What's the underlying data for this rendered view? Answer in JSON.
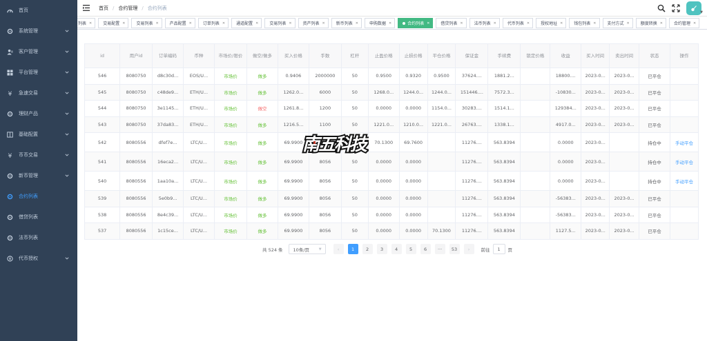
{
  "sidebar": {
    "items": [
      {
        "label": "首页",
        "icon": "dashboard-icon",
        "arrow": false
      },
      {
        "label": "系统管理",
        "icon": "gear-icon",
        "arrow": true
      },
      {
        "label": "客户管理",
        "icon": "user-icon",
        "arrow": true
      },
      {
        "label": "平台管理",
        "icon": "grid-icon",
        "arrow": true
      },
      {
        "label": "急速交易",
        "icon": "yen-icon",
        "arrow": true
      },
      {
        "label": "理财产品",
        "icon": "gear-icon",
        "arrow": true
      },
      {
        "label": "基础配置",
        "icon": "book-icon",
        "arrow": true
      },
      {
        "label": "币币交易",
        "icon": "yen-icon",
        "arrow": true
      },
      {
        "label": "新币管理",
        "icon": "gear-icon",
        "arrow": true
      },
      {
        "label": "合约列表",
        "icon": "gear-icon",
        "arrow": false,
        "active": true
      },
      {
        "label": "借贷列表",
        "icon": "gear-icon",
        "arrow": false
      },
      {
        "label": "法币列表",
        "icon": "gear-icon",
        "arrow": false
      },
      {
        "label": "代币授权",
        "icon": "compass-icon",
        "arrow": true
      }
    ]
  },
  "breadcrumb": {
    "home": "首页",
    "section": "合约管理",
    "current": "合约列表"
  },
  "tags": [
    {
      "label": "列表",
      "active": false
    },
    {
      "label": "交易配置",
      "active": false
    },
    {
      "label": "交易列表",
      "active": false
    },
    {
      "label": "产品配置",
      "active": false
    },
    {
      "label": "订单列表",
      "active": false
    },
    {
      "label": "通道配置",
      "active": false
    },
    {
      "label": "交易列表",
      "active": false
    },
    {
      "label": "资产列表",
      "active": false
    },
    {
      "label": "新币列表",
      "active": false
    },
    {
      "label": "申购数据",
      "active": false
    },
    {
      "label": "合约列表",
      "active": true
    },
    {
      "label": "借贷列表",
      "active": false
    },
    {
      "label": "法币列表",
      "active": false
    },
    {
      "label": "代币列表",
      "active": false
    },
    {
      "label": "授权地址",
      "active": false
    },
    {
      "label": "钱包列表",
      "active": false
    },
    {
      "label": "支付方式",
      "active": false
    },
    {
      "label": "额度转换",
      "active": false
    },
    {
      "label": "合约管理",
      "active": false
    }
  ],
  "table": {
    "headers": [
      "id",
      "用户id",
      "订单编码",
      "币种",
      "市场价/限价",
      "做空/做多",
      "买入价格",
      "手数",
      "杠杆",
      "止盈价格",
      "止损价格",
      "平仓价格",
      "保证金",
      "手续费",
      "锁定价格",
      "收益",
      "买入时间",
      "卖出时间",
      "状态",
      "操作"
    ],
    "rows": [
      [
        "546",
        "8080750",
        "d8c30d...",
        "EOS/U...",
        "市场价",
        "做多",
        "0.9406",
        "2000000",
        "50",
        "0.9500",
        "0.9320",
        "0.9500",
        "37624....",
        "1881.2...",
        "",
        "18800....",
        "2023-0...",
        "2023-0...",
        "已平仓",
        ""
      ],
      [
        "545",
        "8080750",
        "c48de9...",
        "ETH/U...",
        "市场价",
        "做多",
        "1262.0...",
        "6000",
        "50",
        "1268.0...",
        "1244.0...",
        "1244.0...",
        "151446....",
        "7572.3...",
        "",
        "-10830...",
        "2023-0...",
        "2023-0...",
        "已平仓",
        ""
      ],
      [
        "544",
        "8080750",
        "3e1145...",
        "ETH/U...",
        "市场价",
        "做空",
        "1261.8...",
        "1200",
        "50",
        "0.0000",
        "0.0000",
        "1154.0...",
        "30283....",
        "1514.1...",
        "",
        "129384...",
        "2023-0...",
        "2023-0...",
        "已平仓",
        ""
      ],
      [
        "543",
        "8080750",
        "37da83...",
        "ETH/U...",
        "市场价",
        "做多",
        "1216.5...",
        "1100",
        "50",
        "1221.0...",
        "1210.0...",
        "1221.0...",
        "26763....",
        "1338.1...",
        "",
        "4917.0...",
        "2023-0...",
        "2023-0...",
        "已平仓",
        ""
      ],
      [
        "542",
        "8080556",
        "dfef7e...",
        "LTC/U...",
        "市场价",
        "做多",
        "69.9900",
        "8056",
        "50",
        "70.1300",
        "69.7600",
        "",
        "11276....",
        "563.8394",
        "",
        "0.0000",
        "2023-0...",
        "",
        "持仓中",
        "手动平仓"
      ],
      [
        "541",
        "8080556",
        "16eca2...",
        "LTC/U...",
        "市场价",
        "做多",
        "69.9900",
        "8056",
        "50",
        "0.0000",
        "0.0000",
        "",
        "11276....",
        "563.8394",
        "",
        "0.0000",
        "2023-0...",
        "",
        "持仓中",
        "手动平仓"
      ],
      [
        "540",
        "8080556",
        "1aa10a...",
        "LTC/U...",
        "市场价",
        "做多",
        "69.9900",
        "8056",
        "50",
        "0.0000",
        "0.0000",
        "",
        "11276....",
        "563.8394",
        "",
        "0.0000",
        "2023-0...",
        "",
        "持仓中",
        "手动平仓"
      ],
      [
        "539",
        "8080556",
        "5e0b9...",
        "LTC/U...",
        "市场价",
        "做多",
        "69.9900",
        "8056",
        "50",
        "0.0000",
        "0.0000",
        "",
        "11276....",
        "563.8394",
        "",
        "-56383...",
        "2023-0...",
        "2023-0...",
        "已平仓",
        ""
      ],
      [
        "538",
        "8080556",
        "8e4c39...",
        "LTC/U...",
        "市场价",
        "做多",
        "69.9900",
        "8056",
        "50",
        "0.0000",
        "0.0000",
        "",
        "11276....",
        "563.8394",
        "",
        "-56383...",
        "2023-0...",
        "2023-0...",
        "已平仓",
        ""
      ],
      [
        "537",
        "8080556",
        "1c15ce...",
        "LTC/U...",
        "市场价",
        "做多",
        "69.9900",
        "8056",
        "50",
        "0.0000",
        "0.0000",
        "70.1300",
        "11276....",
        "563.8394",
        "",
        "1127.5...",
        "2023-0...",
        "2023-0...",
        "已平仓",
        ""
      ]
    ]
  },
  "pager": {
    "total": "共 524 条",
    "page_size": "10条/页",
    "pages": [
      "1",
      "2",
      "3",
      "4",
      "5",
      "6",
      "···",
      "53"
    ],
    "prev": "‹",
    "next": "›",
    "goto_label": "前往",
    "goto_value": "1",
    "goto_suffix": "页"
  },
  "watermark": "南五科技",
  "colors": {
    "sidebar_bg": "#304156",
    "active": "#409eff",
    "tag_active": "#42b983",
    "long": "#67c23a",
    "short": "#f56c6c"
  }
}
